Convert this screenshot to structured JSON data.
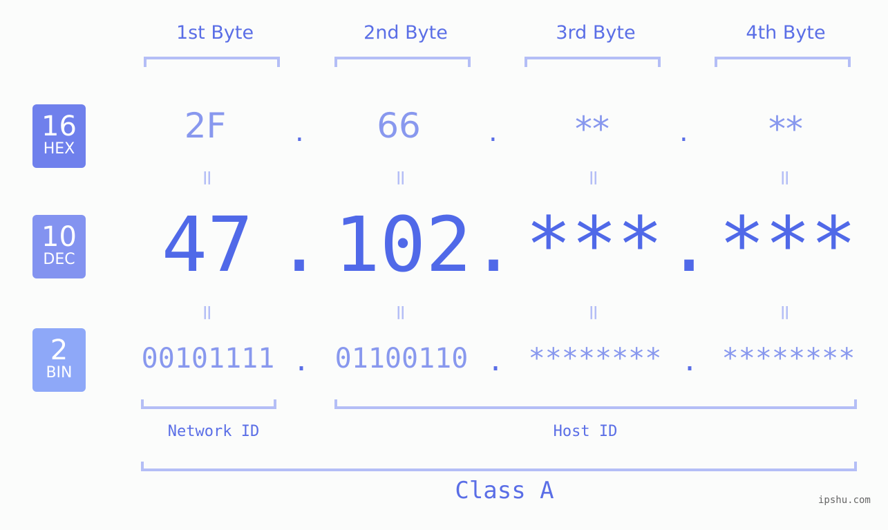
{
  "headers": [
    "1st Byte",
    "2nd Byte",
    "3rd Byte",
    "4th Byte"
  ],
  "badges": {
    "hex": {
      "num": "16",
      "label": "HEX",
      "color": "#6f80ec"
    },
    "dec": {
      "num": "10",
      "label": "DEC",
      "color": "#8393f0"
    },
    "bin": {
      "num": "2",
      "label": "BIN",
      "color": "#8ea8f8"
    }
  },
  "hex": [
    "2F",
    "66",
    "**",
    "**"
  ],
  "dec": [
    "47",
    "102",
    "***",
    "***"
  ],
  "bin": [
    "00101111",
    "01100110",
    "********",
    "********"
  ],
  "dot": ".",
  "equals": "=",
  "labels": {
    "network": "Network ID",
    "host": "Host ID",
    "class": "Class A"
  },
  "watermark": "ipshu.com"
}
